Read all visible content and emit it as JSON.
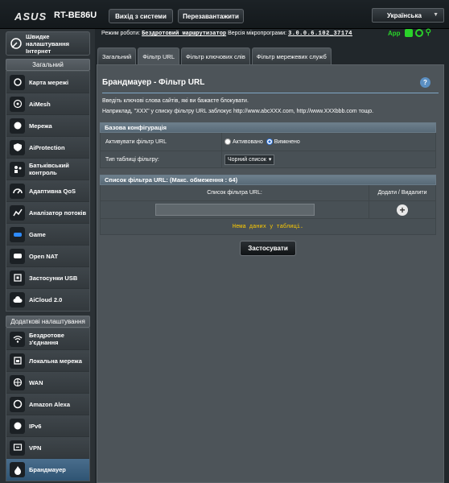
{
  "header": {
    "brand": "ASUS",
    "model": "RT-BE86U",
    "logout_label": "Вихід з системи",
    "reboot_label": "Перезавантажити",
    "language": "Українська"
  },
  "status": {
    "mode_label": "Режим роботи:",
    "mode_value": "Бездротовий маршрутизатор",
    "fw_label": "Версія мікропрограми:",
    "fw_value": "3.0.0.6.102_37174",
    "app_label": "App"
  },
  "sidebar": {
    "quick_setup": "Швидке налаштування Інтернет",
    "general_title": "Загальний",
    "general_items": [
      {
        "label": "Карта мережі",
        "icon": "network-map-icon"
      },
      {
        "label": "AiMesh",
        "icon": "aimesh-icon"
      },
      {
        "label": "Мережа",
        "icon": "network-icon"
      },
      {
        "label": "AiProtection",
        "icon": "aiprotection-icon"
      },
      {
        "label": "Батьківський контроль",
        "icon": "parental-control-icon"
      },
      {
        "label": "Адаптивна QoS",
        "icon": "qos-icon"
      },
      {
        "label": "Аналізатор потоків",
        "icon": "traffic-analyzer-icon"
      },
      {
        "label": "Game",
        "icon": "game-icon"
      },
      {
        "label": "Open NAT",
        "icon": "open-nat-icon"
      },
      {
        "label": "Застосунки USB",
        "icon": "usb-app-icon"
      },
      {
        "label": "AiCloud 2.0",
        "icon": "aicloud-icon"
      }
    ],
    "advanced_title": "Додаткові налаштування",
    "advanced_items": [
      {
        "label": "Бездротове з'єднання",
        "icon": "wireless-icon"
      },
      {
        "label": "Локальна мережа",
        "icon": "lan-icon"
      },
      {
        "label": "WAN",
        "icon": "wan-icon"
      },
      {
        "label": "Amazon Alexa",
        "icon": "alexa-icon"
      },
      {
        "label": "IPv6",
        "icon": "ipv6-icon"
      },
      {
        "label": "VPN",
        "icon": "vpn-icon"
      },
      {
        "label": "Брандмауер",
        "icon": "firewall-icon"
      }
    ]
  },
  "tabs": [
    "Загальний",
    "Фільтр URL",
    "Фільтр ключових слів",
    "Фільтр мережевих служб"
  ],
  "page": {
    "title": "Брандмауер - Фільтр URL",
    "help": "?",
    "desc1": "Введіть ключові слова сайтів, які ви бажаєте блокувати.",
    "desc2": "Наприклад, \"XXX\" у списку фільтру URL заблокує http://www.abcXXX.com, http://www.XXXbbb.com тощо."
  },
  "basic": {
    "header": "Базова конфігурація",
    "enable_label": "Активувати фільтр URL",
    "opt_on": "Активовано",
    "opt_off": "Вимкнено",
    "type_label": "Тип таблиці фільтру:",
    "type_value": "Чорний список"
  },
  "list": {
    "header": "Список фільтра URL: (Макс. обмеження : 64)",
    "col1": "Список фільтра URL:",
    "col2": "Додати / Видалити",
    "add": "+",
    "empty": "Нема даних у таблиці."
  },
  "apply_label": "Застосувати"
}
